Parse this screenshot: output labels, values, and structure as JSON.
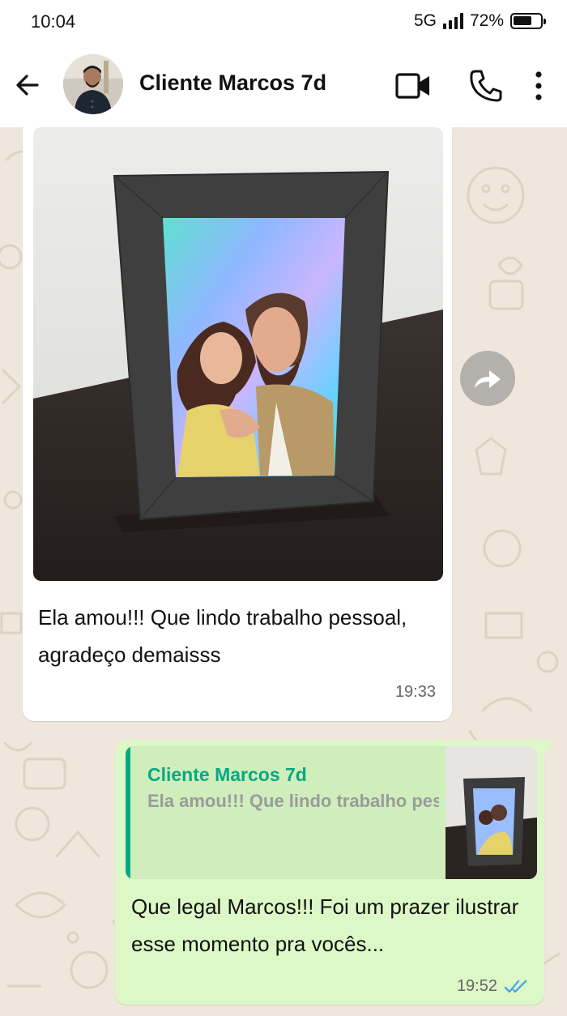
{
  "status": {
    "time": "10:04",
    "network": "5G",
    "battery_label": "72%",
    "battery_level": 0.72
  },
  "header": {
    "contact_name": "Cliente Marcos 7d",
    "icons": [
      "back-arrow-icon",
      "video-call-icon",
      "phone-icon",
      "more-options-icon"
    ]
  },
  "messages": {
    "incoming": {
      "text": "Ela amou!!! Que lindo trabalho pessoal, agradeço demaisss",
      "time": "19:33"
    },
    "outgoing": {
      "quote_author": "Cliente Marcos 7d",
      "quote_text": "Ela amou!!! Que lindo trabalho pessoal, agradeço demaisss",
      "text": "Que legal Marcos!!! Foi um prazer ilustrar esse momento pra vocês...",
      "time": "19:52",
      "status": "read"
    }
  },
  "colors": {
    "accent": "#07a884",
    "outgoing_bubble": "#dcf8c6",
    "chat_background": "#efe7dc",
    "read_ticks": "#53a6e6"
  }
}
